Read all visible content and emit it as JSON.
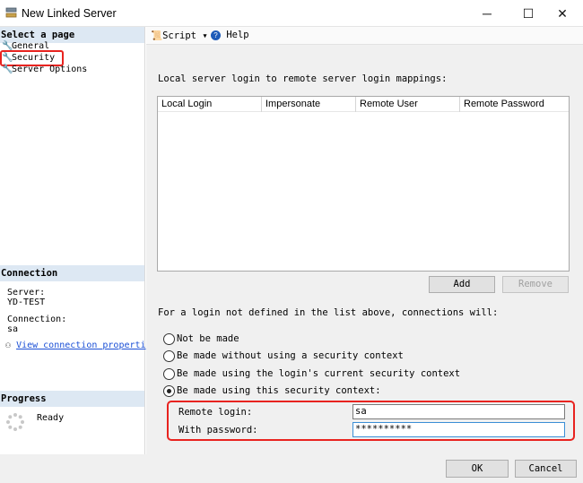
{
  "window": {
    "title": "New Linked Server",
    "minimize_glyph": "─",
    "maximize_glyph": "☐",
    "close_glyph": "✕"
  },
  "left": {
    "select_page_header": "Select a page",
    "pages": [
      {
        "label": "General",
        "icon": "wrench-icon"
      },
      {
        "label": "Security",
        "icon": "wrench-icon",
        "selected": true
      },
      {
        "label": "Server Options",
        "icon": "wrench-icon"
      }
    ],
    "connection_header": "Connection",
    "server_label": "Server:",
    "server_value": "YD-TEST",
    "connection_label": "Connection:",
    "connection_value": "sa",
    "view_link": "View connection properti",
    "progress_header": "Progress",
    "progress_status": "Ready"
  },
  "toolbar": {
    "script_label": "Script",
    "help_label": "Help"
  },
  "main": {
    "mappings_label": "Local server login to remote server login mappings:",
    "columns": [
      "Local Login",
      "Impersonate",
      "Remote User",
      "Remote Password"
    ],
    "add_label": "Add",
    "remove_label": "Remove",
    "not_defined_label": "For a login not defined in the list above, connections will:",
    "options": [
      "Not be made",
      "Be made without using a security context",
      "Be made using the login's current security context",
      "Be made using this security context:"
    ],
    "selected_option_index": 3,
    "remote_login_label": "Remote login:",
    "remote_login_value": "sa",
    "password_label": "With password:",
    "password_value": "**********"
  },
  "footer": {
    "ok_label": "OK",
    "cancel_label": "Cancel"
  },
  "colors": {
    "highlight": "#e8231f",
    "header_bg": "#dde8f3",
    "link": "#1a4fd6"
  }
}
